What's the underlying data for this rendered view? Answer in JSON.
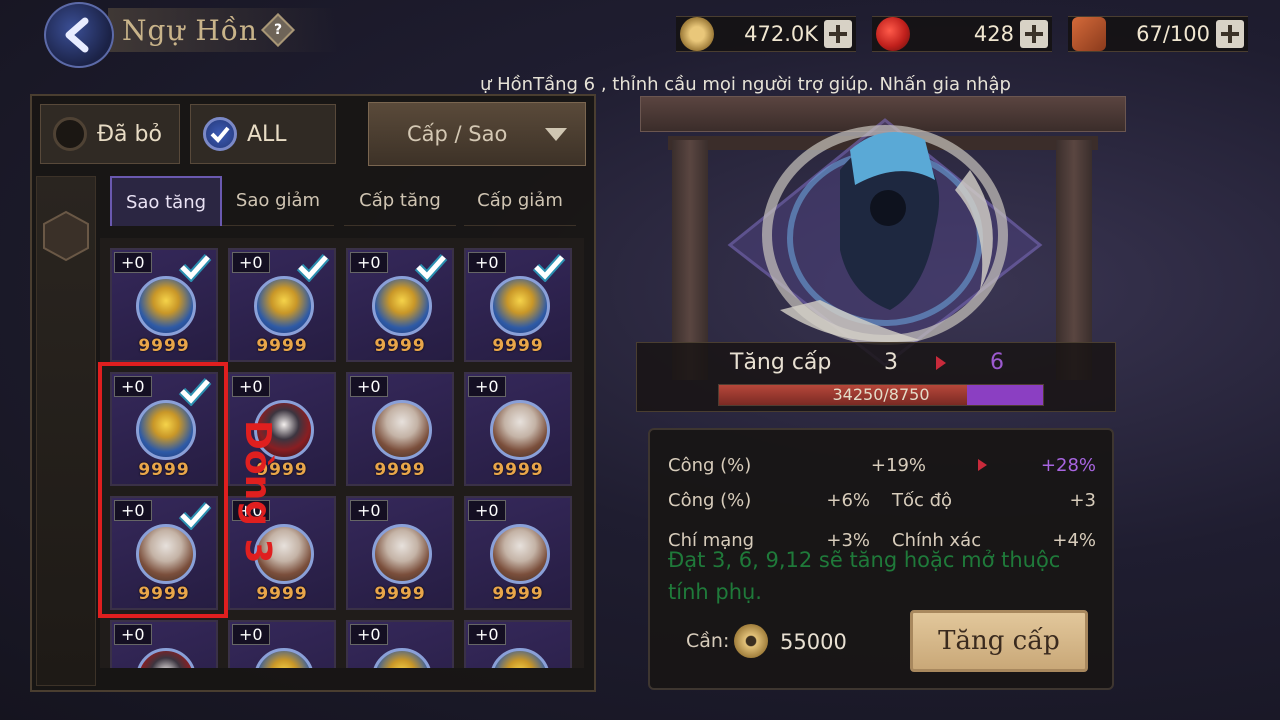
{
  "header": {
    "title": "Ngự Hồn",
    "help_symbol": "?",
    "resources": [
      {
        "icon": "coin-icon",
        "value": "472.0K"
      },
      {
        "icon": "red-orb-icon",
        "value": "428"
      },
      {
        "icon": "meat-icon",
        "value": "67/100"
      }
    ]
  },
  "announcement": "ự HồnTầng 6 , thỉnh cầu mọi người trợ giúp. Nhấn gia nhập",
  "filters": {
    "discarded_label": "Đã bỏ",
    "all_label": "ALL",
    "sort_dropdown": "Cấp / Sao"
  },
  "sort_tabs": [
    "Sao tăng",
    "Sao giảm",
    "Cấp tăng",
    "Cấp giảm"
  ],
  "active_tab": "Sao tăng",
  "inventory": {
    "rows": [
      [
        {
          "level": "+0",
          "stars": "9999",
          "checked": true,
          "portrait": "blue"
        },
        {
          "level": "+0",
          "stars": "9999",
          "checked": true,
          "portrait": "blue"
        },
        {
          "level": "+0",
          "stars": "9999",
          "checked": true,
          "portrait": "blue"
        },
        {
          "level": "+0",
          "stars": "9999",
          "checked": true,
          "portrait": "blue"
        }
      ],
      [
        {
          "level": "+0",
          "stars": "9999",
          "checked": true,
          "portrait": "blue"
        },
        {
          "level": "+0",
          "stars": "9999",
          "checked": false,
          "portrait": "dark"
        },
        {
          "level": "+0",
          "stars": "9999",
          "checked": false,
          "portrait": "girl"
        },
        {
          "level": "+0",
          "stars": "9999",
          "checked": false,
          "portrait": "girl"
        }
      ],
      [
        {
          "level": "+0",
          "stars": "9999",
          "checked": true,
          "portrait": "girl"
        },
        {
          "level": "+0",
          "stars": "9999",
          "checked": false,
          "portrait": "girl"
        },
        {
          "level": "+0",
          "stars": "9999",
          "checked": false,
          "portrait": "girl"
        },
        {
          "level": "+0",
          "stars": "9999",
          "checked": false,
          "portrait": "girl"
        }
      ],
      [
        {
          "level": "+0",
          "stars": "",
          "checked": false,
          "portrait": "dark"
        },
        {
          "level": "+0",
          "stars": "",
          "checked": false,
          "portrait": "blue"
        },
        {
          "level": "+0",
          "stars": "",
          "checked": false,
          "portrait": "blue"
        },
        {
          "level": "+0",
          "stars": "",
          "checked": false,
          "portrait": "blue"
        }
      ]
    ]
  },
  "annotation": {
    "label": "Dòng 3",
    "color": "#e01f1f"
  },
  "upgrade": {
    "label": "Tăng cấp",
    "from_level": "3",
    "to_level": "6",
    "xp_text": "34250/8750",
    "xp_fill_fraction": 0.76,
    "xp_extra_fraction": 0.24
  },
  "stats": {
    "main": {
      "label": "Công (%)",
      "current": "+19%",
      "next": "+28%"
    },
    "subs": [
      {
        "label": "Công (%)",
        "value": "+6%"
      },
      {
        "label": "Tốc độ",
        "value": "+3"
      },
      {
        "label": "Chí mạng",
        "value": "+3%"
      },
      {
        "label": "Chính xác",
        "value": "+4%"
      }
    ],
    "hint": "Đạt 3, 6, 9,12 sẽ tăng hoặc mở thuộc tính phụ."
  },
  "cost": {
    "label": "Cần:",
    "value": "55000"
  },
  "upgrade_button": "Tăng cấp",
  "colors": {
    "accent_purple": "#a865e0",
    "hint_green": "#1f7a3a",
    "star_orange": "#e9a64a"
  }
}
